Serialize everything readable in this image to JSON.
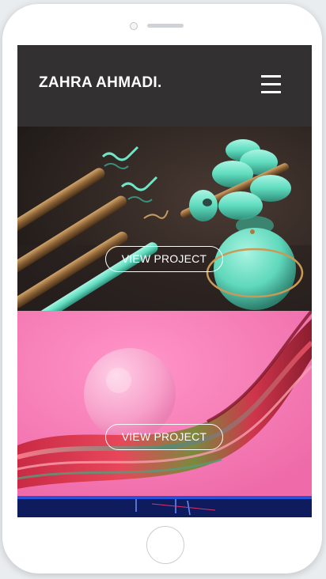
{
  "header": {
    "brand": "ZAHRA AHMADI.",
    "menu_icon": "hamburger-menu-icon"
  },
  "projects": [
    {
      "button_label": "VIEW PROJECT"
    },
    {
      "button_label": "VIEW PROJECT"
    }
  ],
  "colors": {
    "topbar": "#323030",
    "accent_mint": "#6fe6c8",
    "pink_background": "#f47fb6",
    "navy_strip": "#10206a"
  }
}
